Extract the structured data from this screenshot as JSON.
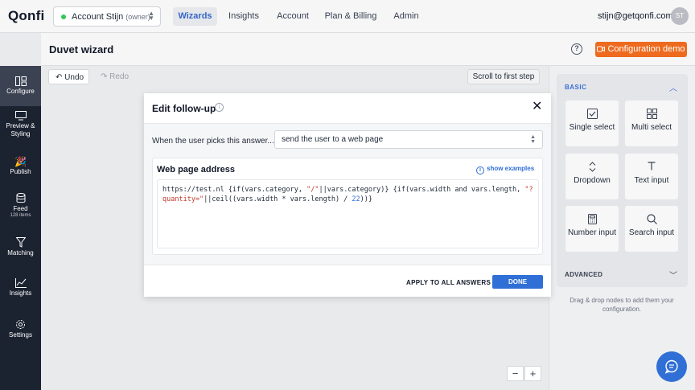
{
  "app": {
    "logo": "Qonfi"
  },
  "account": {
    "name": "Account Stijn",
    "role": "(owner)",
    "status_color": "#34c759"
  },
  "nav": {
    "tabs": [
      "Wizards",
      "Insights",
      "Account",
      "Plan & Billing",
      "Admin"
    ],
    "active": "Wizards",
    "email": "stijn@getqonfi.com",
    "avatar_initials": "ST"
  },
  "sidebar": {
    "items": [
      {
        "label": "Configure",
        "icon": "configure-icon",
        "active": true
      },
      {
        "label": "Preview & Styling",
        "icon": "monitor-icon"
      },
      {
        "label": "Publish",
        "icon": "party-popper-icon"
      },
      {
        "label": "Feed",
        "sub": "128 items",
        "icon": "database-icon"
      },
      {
        "label": "Matching",
        "icon": "funnel-icon"
      },
      {
        "label": "Insights",
        "icon": "chart-line-icon"
      },
      {
        "label": "Settings",
        "icon": "gear-icon"
      }
    ]
  },
  "header": {
    "title": "Duvet wizard",
    "demo_label": "Configuration demo",
    "accent": "#ee6a1e"
  },
  "toolbar": {
    "undo": "Undo",
    "redo": "Redo",
    "scroll_first": "Scroll to first step"
  },
  "zoom": {
    "minus": "−",
    "plus": "+"
  },
  "modal": {
    "title": "Edit follow-up",
    "pick_label": "When the user picks this answer...",
    "pick_value": "send the user to a web page",
    "address_title": "Web page address",
    "show_examples": "show examples",
    "code": {
      "part1": "https://test.nl {if(vars.category, ",
      "str1": "\"/\"",
      "part2": "||vars.category)} {if(vars.width and vars.length, ",
      "str2": "\"?quantity=\"",
      "part3": "||ceil((vars.width * vars.length) / ",
      "num1": "22",
      "part4": "))}"
    },
    "apply_all": "APPLY TO ALL ANSWERS",
    "done": "DONE"
  },
  "palette": {
    "basic_label": "BASIC",
    "tiles": [
      {
        "label": "Single select",
        "icon": "checkbox-icon"
      },
      {
        "label": "Multi select",
        "icon": "grid-icon"
      },
      {
        "label": "Dropdown",
        "icon": "chevron-updown-icon"
      },
      {
        "label": "Text input",
        "icon": "text-t-icon"
      },
      {
        "label": "Number input",
        "icon": "calculator-icon"
      },
      {
        "label": "Search input",
        "icon": "search-icon"
      }
    ],
    "advanced_label": "ADVANCED",
    "hint": "Drag & drop nodes to add them your configuration."
  },
  "accent_blue": "#2f6fd6"
}
